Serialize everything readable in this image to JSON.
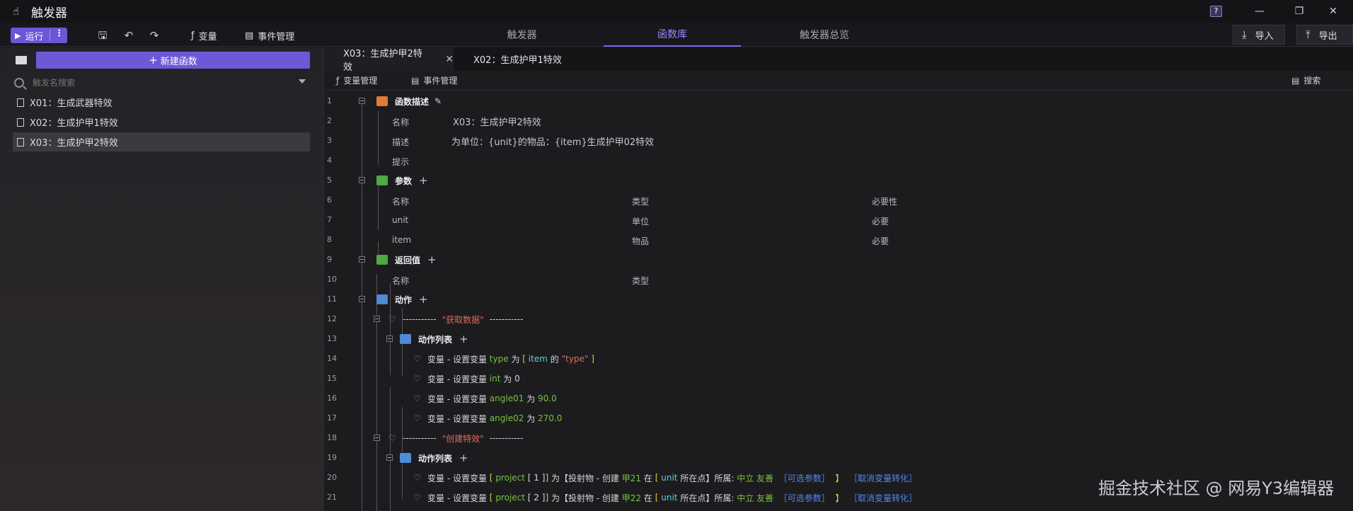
{
  "app": {
    "title": "触发器"
  },
  "window": {
    "help_icon": "help-icon",
    "minimize": "minimize-icon",
    "maximize": "restore-icon",
    "close": "close-icon"
  },
  "toolbar": {
    "run_label": "运行",
    "variables_label": "变量",
    "events_label": "事件管理",
    "import_label": "导入",
    "export_label": "导出"
  },
  "main_tabs": [
    {
      "label": "触发器",
      "active": false
    },
    {
      "label": "函数库",
      "active": true
    },
    {
      "label": "触发器总览",
      "active": false
    }
  ],
  "left": {
    "new_button": "新建函数",
    "search_placeholder": "触发名搜索",
    "items": [
      {
        "label": "X01：生成武器特效"
      },
      {
        "label": "X02：生成护甲1特效"
      },
      {
        "label": "X03：生成护甲2特效"
      }
    ]
  },
  "editor": {
    "tabs": [
      {
        "label": "X03：生成护甲2特效",
        "active": true
      },
      {
        "label": "X02：生成护甲1特效",
        "active": false
      }
    ],
    "tool_variables": "变量管理",
    "tool_events": "事件管理",
    "tool_search": "搜索",
    "line_numbers": [
      "1",
      "2",
      "3",
      "4",
      "5",
      "6",
      "7",
      "8",
      "9",
      "10",
      "11",
      "12",
      "13",
      "14",
      "15",
      "16",
      "17",
      "18",
      "19",
      "20",
      "21"
    ],
    "desc": {
      "header": "函数描述",
      "name_label": "名称",
      "name_value": "X03：生成护甲2特效",
      "desc_label": "描述",
      "desc_value": "为单位：{unit}的物品：{item}生成护甲02特效",
      "hint_label": "提示"
    },
    "params": {
      "header": "参数",
      "col_name": "名称",
      "col_type": "类型",
      "col_required": "必要性",
      "rows": [
        {
          "name": "unit",
          "type": "单位",
          "required": "必要"
        },
        {
          "name": "item",
          "type": "物品",
          "required": "必要"
        }
      ]
    },
    "returns": {
      "header": "返回值",
      "col_name": "名称",
      "col_type": "类型"
    },
    "actions": {
      "header": "动作",
      "group1_dashes": "-----------",
      "group1_title": "\"获取数据\"",
      "list_label": "动作列表",
      "l14": {
        "a": "变量 - 设置变量",
        "var": "type",
        "b": "为",
        "br1": "[",
        "c": "item",
        "d": "的",
        "e": "\"type\"",
        "br2": "]"
      },
      "l15": {
        "a": "变量 - 设置变量",
        "var": "int",
        "b": "为",
        "c": "0"
      },
      "l16": {
        "a": "变量 - 设置变量",
        "var": "angle01",
        "b": "为",
        "c": "90.0"
      },
      "l17": {
        "a": "变量 - 设置变量",
        "var": "angle02",
        "b": "为",
        "c": "270.0"
      },
      "group2_title": "\"创建特效\"",
      "l20": {
        "a": "变量 - 设置变量",
        "br1": "[",
        "var": "project",
        "idx": "[ 1 ]",
        "br2": "]",
        "b": "为",
        "c": "【投射物 - 创建",
        "d": "甲21",
        "e": "在",
        "br3": "[",
        "f": "unit",
        "g": "所在点",
        "h": "】所属:",
        "i": "中立",
        "j": "友善",
        "k": "［可选参数］",
        "br4": "】",
        "l": "［取消变量转化］"
      },
      "l21": {
        "a": "变量 - 设置变量",
        "br1": "[",
        "var": "project",
        "idx": "[ 2 ]",
        "br2": "]",
        "b": "为",
        "c": "【投射物 - 创建",
        "d": "甲22",
        "e": "在",
        "br3": "[",
        "f": "unit",
        "g": "所在点",
        "h": "】所属:",
        "i": "中立",
        "j": "友善",
        "k": "［可选参数］",
        "br4": "】",
        "l": "［取消变量转化］"
      }
    }
  },
  "watermark": "掘金技术社区 @ 网易Y3编辑器"
}
